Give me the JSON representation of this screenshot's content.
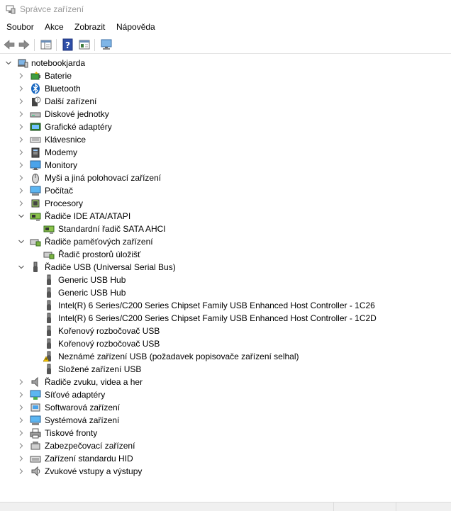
{
  "window": {
    "title": "Správce zařízení"
  },
  "menu": [
    "Soubor",
    "Akce",
    "Zobrazit",
    "Nápověda"
  ],
  "tree": {
    "root": "notebookjarda",
    "categories": [
      {
        "label": "Baterie",
        "icon": "battery-icon",
        "expanded": false
      },
      {
        "label": "Bluetooth",
        "icon": "bluetooth-icon",
        "expanded": false
      },
      {
        "label": "Další zařízení",
        "icon": "other-devices-icon",
        "expanded": false
      },
      {
        "label": "Diskové jednotky",
        "icon": "disk-drive-icon",
        "expanded": false
      },
      {
        "label": "Grafické adaptéry",
        "icon": "display-adapter-icon",
        "expanded": false
      },
      {
        "label": "Klávesnice",
        "icon": "keyboard-icon",
        "expanded": false
      },
      {
        "label": "Modemy",
        "icon": "modem-icon",
        "expanded": false
      },
      {
        "label": "Monitory",
        "icon": "monitor-icon",
        "expanded": false
      },
      {
        "label": "Myši a jiná polohovací zařízení",
        "icon": "mouse-icon",
        "expanded": false
      },
      {
        "label": "Počítač",
        "icon": "computer-icon",
        "expanded": false
      },
      {
        "label": "Procesory",
        "icon": "processor-icon",
        "expanded": false
      },
      {
        "label": "Řadiče IDE ATA/ATAPI",
        "icon": "ide-controller-icon",
        "expanded": true,
        "children": [
          {
            "label": "Standardní řadič  SATA AHCI",
            "icon": "ide-controller-icon"
          }
        ]
      },
      {
        "label": "Řadiče paměťových zařízení",
        "icon": "storage-controller-icon",
        "expanded": true,
        "children": [
          {
            "label": "Řadič prostorů úložišť",
            "icon": "storage-controller-icon"
          }
        ]
      },
      {
        "label": "Řadiče USB (Universal Serial Bus)",
        "icon": "usb-icon",
        "expanded": true,
        "children": [
          {
            "label": "Generic USB Hub",
            "icon": "usb-icon"
          },
          {
            "label": "Generic USB Hub",
            "icon": "usb-icon"
          },
          {
            "label": "Intel(R) 6 Series/C200 Series Chipset Family USB Enhanced Host Controller - 1C26",
            "icon": "usb-icon"
          },
          {
            "label": "Intel(R) 6 Series/C200 Series Chipset Family USB Enhanced Host Controller - 1C2D",
            "icon": "usb-icon"
          },
          {
            "label": "Kořenový rozbočovač USB",
            "icon": "usb-icon"
          },
          {
            "label": "Kořenový rozbočovač USB",
            "icon": "usb-icon"
          },
          {
            "label": "Neznámé zařízení USB (požadavek popisovače zařízení selhal)",
            "icon": "usb-warning-icon"
          },
          {
            "label": "Složené zařízení USB",
            "icon": "usb-icon"
          }
        ]
      },
      {
        "label": "Řadiče zvuku, videa a her",
        "icon": "sound-icon",
        "expanded": false
      },
      {
        "label": "Síťové adaptéry",
        "icon": "network-adapter-icon",
        "expanded": false
      },
      {
        "label": "Softwarová zařízení",
        "icon": "software-device-icon",
        "expanded": false
      },
      {
        "label": "Systémová zařízení",
        "icon": "system-device-icon",
        "expanded": false
      },
      {
        "label": "Tiskové fronty",
        "icon": "printer-icon",
        "expanded": false
      },
      {
        "label": "Zabezpečovací zařízení",
        "icon": "security-device-icon",
        "expanded": false
      },
      {
        "label": "Zařízení standardu HID",
        "icon": "hid-icon",
        "expanded": false
      },
      {
        "label": "Zvukové vstupy a výstupy",
        "icon": "audio-io-icon",
        "expanded": false
      }
    ]
  }
}
